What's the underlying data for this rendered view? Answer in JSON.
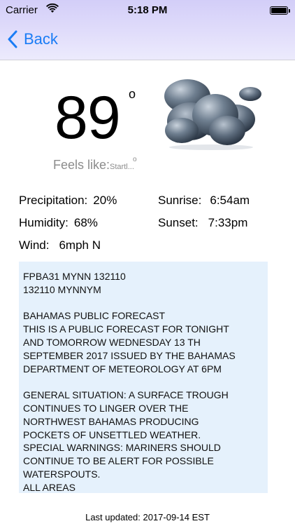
{
  "status_bar": {
    "carrier": "Carrier",
    "time": "5:18 PM"
  },
  "nav": {
    "back_label": "Back"
  },
  "current": {
    "temperature": "89",
    "degree_symbol": "o",
    "feels_like_label": "Feels like:",
    "feels_like_value": "Startl...",
    "feels_like_degree": "o"
  },
  "stats": {
    "precipitation_label": "Precipitation:",
    "precipitation_value": "20%",
    "humidity_label": "Humidity:",
    "humidity_value": "68%",
    "wind_label": "Wind:",
    "wind_value": "6mph N",
    "sunrise_label": "Sunrise:",
    "sunrise_value": "6:54am",
    "sunset_label": "Sunset:",
    "sunset_value": "7:33pm"
  },
  "forecast_text": "FPBA31 MYNN 132110\n132110 MYNNYM\n\nBAHAMAS PUBLIC FORECAST\nTHIS IS A PUBLIC FORECAST FOR TONIGHT\nAND TOMORROW WEDNESDAY 13 TH\nSEPTEMBER 2017 ISSUED BY THE BAHAMAS\nDEPARTMENT OF METEOROLOGY AT 6PM\n\nGENERAL SITUATION: A SURFACE TROUGH\nCONTINUES TO LINGER OVER THE\nNORTHWEST BAHAMAS PRODUCING\nPOCKETS OF UNSETTLED WEATHER.\nSPECIAL WARNINGS: MARINERS SHOULD\nCONTINUE TO BE ALERT FOR POSSIBLE\nWATERSPOUTS.\nALL AREAS",
  "footer": {
    "last_updated": "Last updated: 2017-09-14 EST"
  },
  "icons": {
    "weather": "cloud-icon"
  }
}
